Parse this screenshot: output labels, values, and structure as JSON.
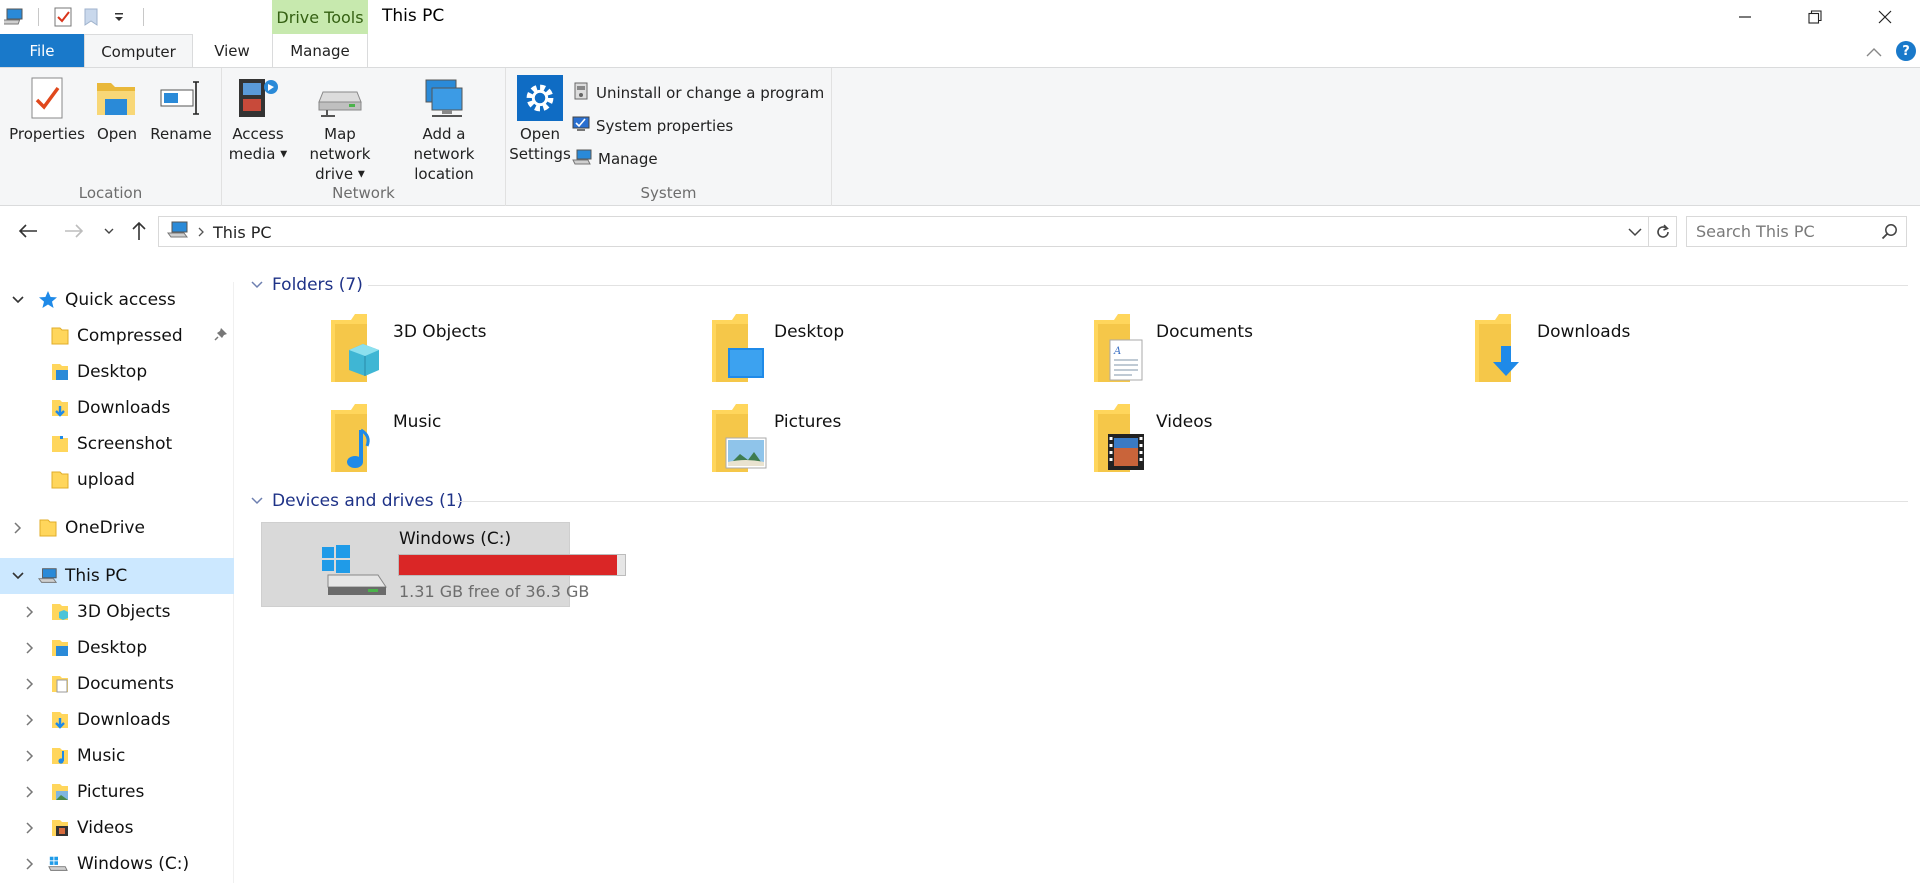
{
  "window": {
    "title": "This PC",
    "context_tab": "Drive Tools"
  },
  "tabs": {
    "file": "File",
    "computer": "Computer",
    "view": "View",
    "manage": "Manage"
  },
  "ribbon": {
    "location": {
      "label": "Location",
      "properties": "Properties",
      "open": "Open",
      "rename": "Rename"
    },
    "network": {
      "label": "Network",
      "access_media_1": "Access",
      "access_media_2": "media",
      "map_drive_1": "Map network",
      "map_drive_2": "drive",
      "add_location_1": "Add a network",
      "add_location_2": "location"
    },
    "system": {
      "label": "System",
      "open_settings_1": "Open",
      "open_settings_2": "Settings",
      "uninstall": "Uninstall or change a program",
      "system_properties": "System properties",
      "manage": "Manage"
    }
  },
  "address": {
    "path": "This PC",
    "search_placeholder": "Search This PC"
  },
  "nav": {
    "quick_access": "Quick access",
    "quick_items": [
      "Compressed",
      "Desktop",
      "Downloads",
      "Screenshot",
      "upload"
    ],
    "onedrive": "OneDrive",
    "this_pc": "This PC",
    "pc_items": [
      "3D Objects",
      "Desktop",
      "Documents",
      "Downloads",
      "Music",
      "Pictures",
      "Videos",
      "Windows (C:)"
    ]
  },
  "content": {
    "folders_header": "Folders (7)",
    "folders": [
      "3D Objects",
      "Desktop",
      "Documents",
      "Downloads",
      "Music",
      "Pictures",
      "Videos"
    ],
    "devices_header": "Devices and drives (1)",
    "drive": {
      "name": "Windows (C:)",
      "free_text": "1.31 GB free of 36.3 GB",
      "used_fraction": 0.964
    }
  },
  "colors": {
    "accent": "#1979ca",
    "selection": "#cce8ff",
    "drive_bar_full": "#da2626",
    "context_tab_bg": "#c7e9ae",
    "section_header": "#1e3287"
  }
}
